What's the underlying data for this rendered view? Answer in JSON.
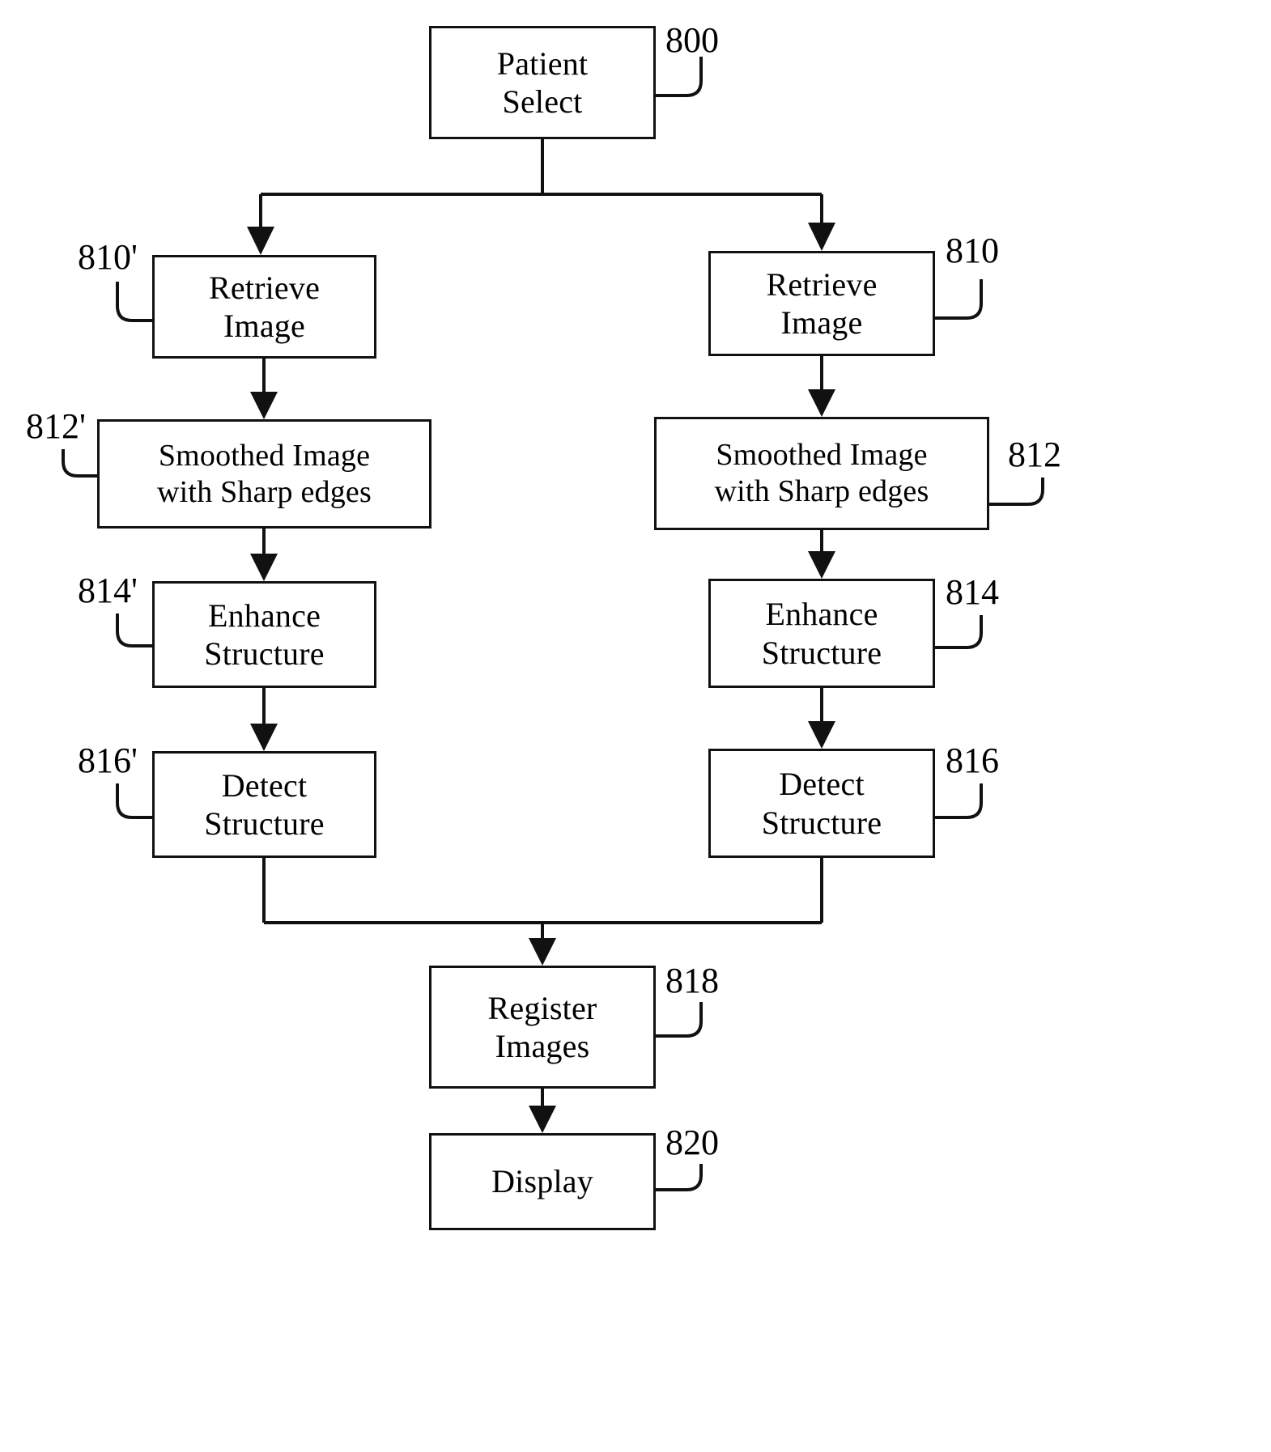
{
  "figure": {
    "kind": "patent-flowchart",
    "nodes": [
      {
        "id": "patient_select",
        "lines": [
          "Patient",
          "Select"
        ],
        "ref": "800"
      },
      {
        "id": "retrieve_left",
        "lines": [
          "Retrieve",
          "Image"
        ],
        "ref": "810'"
      },
      {
        "id": "retrieve_right",
        "lines": [
          "Retrieve",
          "Image"
        ],
        "ref": "810"
      },
      {
        "id": "smoothed_left",
        "lines": [
          "Smoothed Image",
          "with Sharp edges"
        ],
        "ref": "812'"
      },
      {
        "id": "smoothed_right",
        "lines": [
          "Smoothed Image",
          "with Sharp edges"
        ],
        "ref": "812"
      },
      {
        "id": "enhance_left",
        "lines": [
          "Enhance",
          "Structure"
        ],
        "ref": "814'"
      },
      {
        "id": "enhance_right",
        "lines": [
          "Enhance",
          "Structure"
        ],
        "ref": "814"
      },
      {
        "id": "detect_left",
        "lines": [
          "Detect",
          "Structure"
        ],
        "ref": "816'"
      },
      {
        "id": "detect_right",
        "lines": [
          "Detect",
          "Structure"
        ],
        "ref": "816"
      },
      {
        "id": "register_images",
        "lines": [
          "Register",
          "Images"
        ],
        "ref": "818"
      },
      {
        "id": "display",
        "lines": [
          "Display"
        ],
        "ref": "820"
      }
    ],
    "refs": {
      "r800": "800",
      "r810p": "810'",
      "r810": "810",
      "r812p": "812'",
      "r812": "812",
      "r814p": "814'",
      "r814": "814",
      "r816p": "816'",
      "r816": "816",
      "r818": "818",
      "r820": "820"
    },
    "labels": {
      "patient_l1": "Patient",
      "patient_l2": "Select",
      "retrieve_l1": "Retrieve",
      "retrieve_l2": "Image",
      "retrieve_r1": "Retrieve",
      "retrieve_r2": "Image",
      "smoothed_l1": "Smoothed Image",
      "smoothed_l2": "with Sharp edges",
      "smoothed_r1": "Smoothed Image",
      "smoothed_r2": "with Sharp edges",
      "enhance_l1": "Enhance",
      "enhance_l2": "Structure",
      "enhance_r1": "Enhance",
      "enhance_r2": "Structure",
      "detect_l1": "Detect",
      "detect_l2": "Structure",
      "detect_r1": "Detect",
      "detect_r2": "Structure",
      "register_1": "Register",
      "register_2": "Images",
      "display_1": "Display"
    },
    "colors": {
      "stroke": "#111111",
      "background": "#ffffff",
      "text": "#000000"
    }
  }
}
